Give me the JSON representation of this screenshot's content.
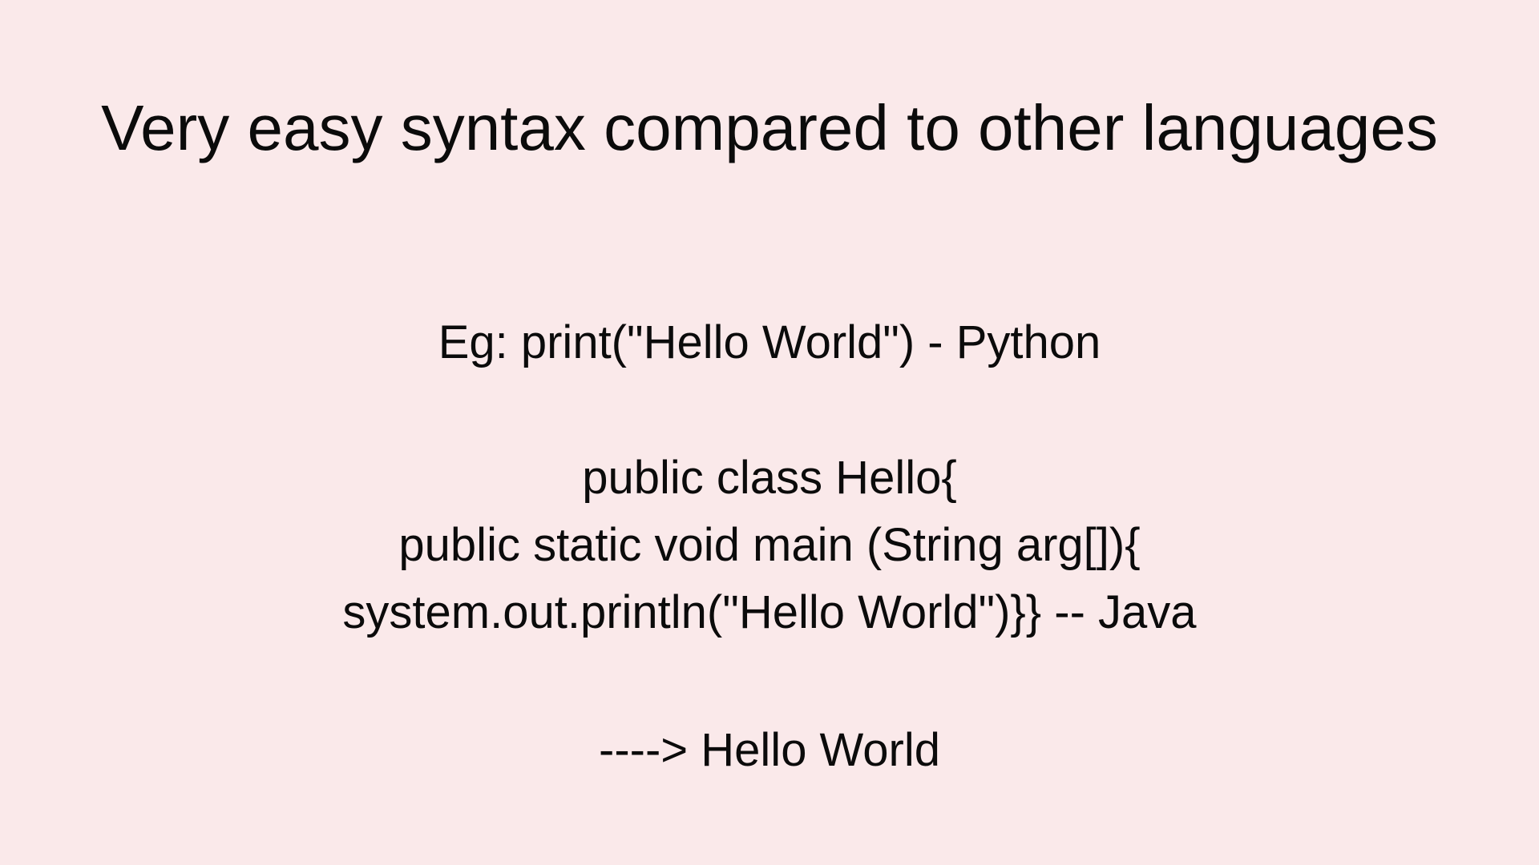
{
  "colors": {
    "background": "#fae9ea",
    "text": "#0b0b0b"
  },
  "slide": {
    "title": "Very easy syntax compared to other languages",
    "python_example": "Eg: print(\"Hello World\") - Python",
    "java_example": [
      "public class Hello{",
      "public static void main (String arg[]){",
      "system.out.println(\"Hello World\")}} -- Java"
    ],
    "output": "----> Hello World"
  }
}
